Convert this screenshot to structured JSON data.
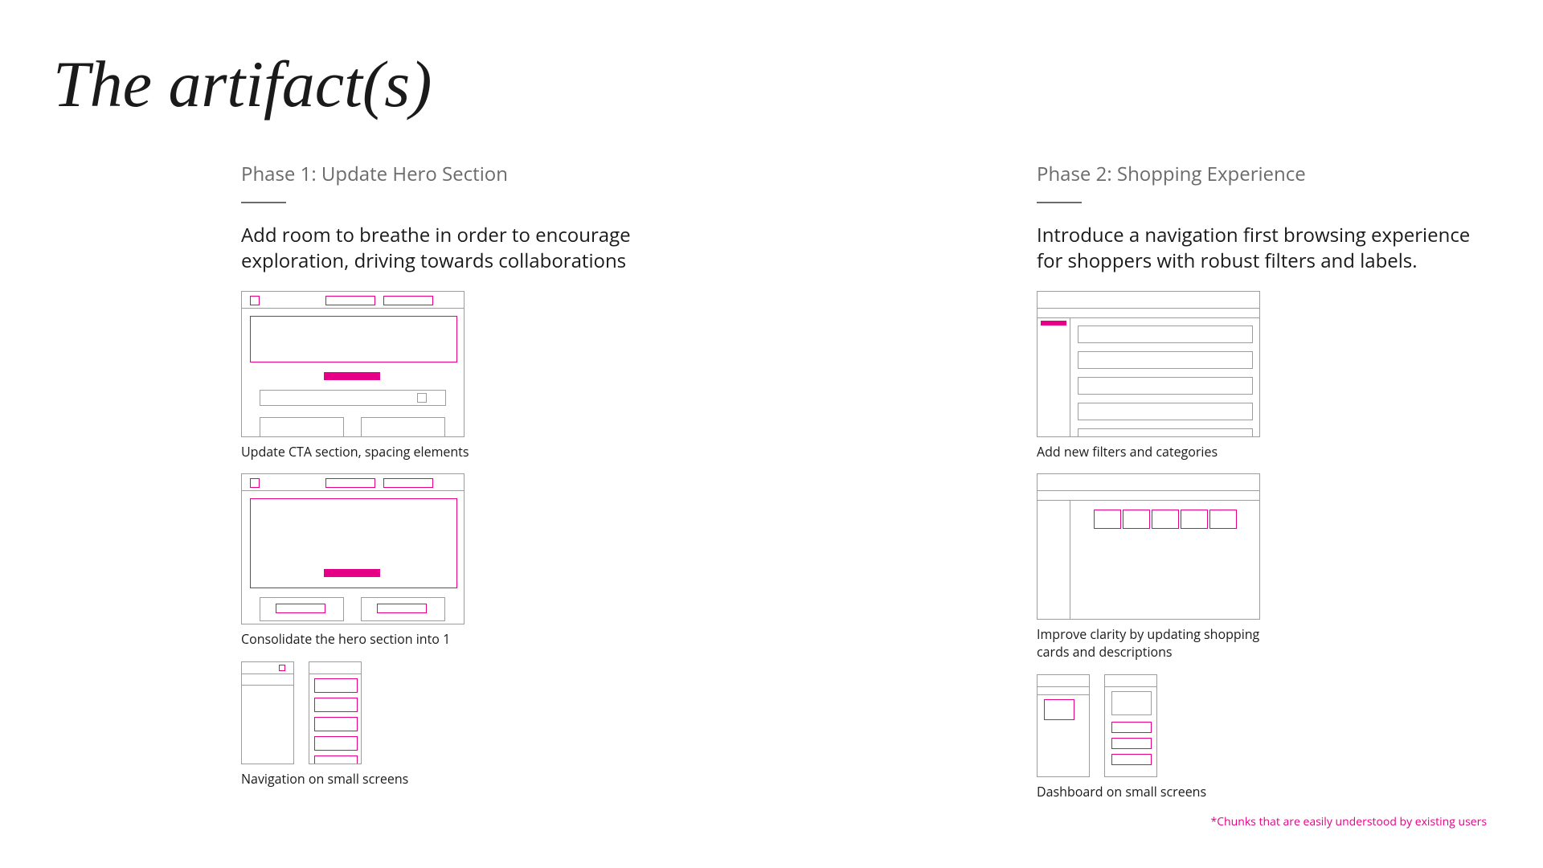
{
  "title": "The artifact(s)",
  "accent": "#e60087",
  "phase1": {
    "label": "Phase 1: Update Hero Section",
    "description": "Add room to breathe in order to encourage exploration, driving towards collaborations",
    "captions": {
      "wf1": "Update CTA section, spacing elements",
      "wf2": "Consolidate the hero section into 1",
      "wf3": "Navigation on small screens"
    }
  },
  "phase2": {
    "label": "Phase 2: Shopping Experience",
    "description": "Introduce a navigation first browsing experience for shoppers with robust filters and labels.",
    "captions": {
      "wf1": "Add new filters and categories",
      "wf2": "Improve clarity by updating shopping cards and descriptions",
      "wf3": "Dashboard on small screens"
    }
  },
  "footnote": "*Chunks that are easily understood by existing users"
}
